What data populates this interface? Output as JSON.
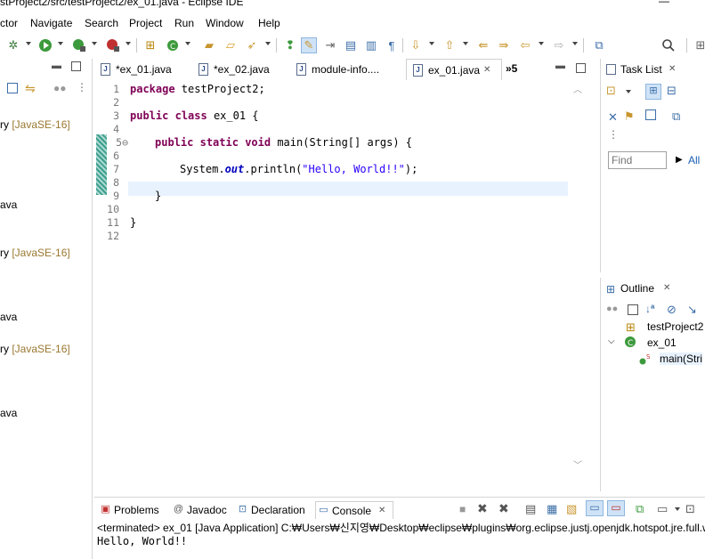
{
  "window": {
    "title": "stProject2/src/testProject2/ex_01.java - Eclipse IDE",
    "minimize_glyph": "—"
  },
  "menubar": {
    "items": [
      "ctor",
      "Navigate",
      "Search",
      "Project",
      "Run",
      "Window",
      "Help"
    ]
  },
  "toolbar": {
    "icons": [
      "debug-icon",
      "run-icon",
      "coverage-icon",
      "external-tools-icon",
      "new-package-icon",
      "new-class-icon",
      "open-type-icon",
      "open-folder-icon",
      "search-icon",
      "annotation-icon",
      "highlight-icon",
      "word-wrap-icon",
      "paragraph-icon",
      "next-annotation-icon",
      "prev-annotation-icon",
      "last-edit-icon",
      "back-icon",
      "forward-icon",
      "pin-icon",
      "quick-access-icon",
      "perspective-icon"
    ]
  },
  "left_panel": {
    "items": [
      {
        "text": "ry ",
        "lib": "[JavaSE-16]"
      },
      {
        "text": "ava",
        "lib": ""
      },
      {
        "text": "ry ",
        "lib": "[JavaSE-16]"
      },
      {
        "text": "ava",
        "lib": ""
      },
      {
        "text": "ry ",
        "lib": "[JavaSE-16]"
      },
      {
        "text": "ava",
        "lib": ""
      }
    ]
  },
  "editor": {
    "tabs": [
      {
        "label": "*ex_01.java",
        "active": false
      },
      {
        "label": "*ex_02.java",
        "active": false
      },
      {
        "label": "module-info....",
        "active": false
      },
      {
        "label": "ex_01.java",
        "active": true,
        "close": "✕"
      }
    ],
    "overflow": "»5",
    "line_numbers": [
      "1",
      "2",
      "3",
      "4",
      "5⊖",
      "6",
      "7",
      "8",
      "9",
      "10",
      "11",
      "12"
    ],
    "code": {
      "l1_kw": "package",
      "l1_rest": " testProject2;",
      "l3_kw1": "public",
      "l3_kw2": "class",
      "l3_rest": " ex_01 {",
      "l5_kw1": "public",
      "l5_kw2": "static",
      "l5_kw3": "void",
      "l5_rest": " main(String[] args) {",
      "l7_a": "System.",
      "l7_field": "out",
      "l7_b": ".println(",
      "l7_str": "\"Hello, World!!\"",
      "l7_c": ");",
      "l9": "}",
      "l11": "}"
    }
  },
  "task_list": {
    "title": "Task List",
    "close": "✕",
    "find_placeholder": "Find",
    "all_label": "All"
  },
  "outline": {
    "title": "Outline",
    "close": "✕",
    "package": "testProject2",
    "class": "ex_01",
    "method": "main(Stri"
  },
  "console": {
    "tabs": [
      "Problems",
      "Javadoc",
      "Declaration",
      "Console"
    ],
    "close": "✕",
    "status": "<terminated> ex_01 [Java Application] C:₩Users₩신지영₩Desktop₩eclipse₩plugins₩org.eclipse.justj.openjdk.hotspot.jre.full.wi",
    "output": "Hello, World!!"
  },
  "colors": {
    "keyword": "#7f0055",
    "string": "#2a00ff",
    "field": "#0000c0",
    "current_line": "#e8f2fe"
  }
}
